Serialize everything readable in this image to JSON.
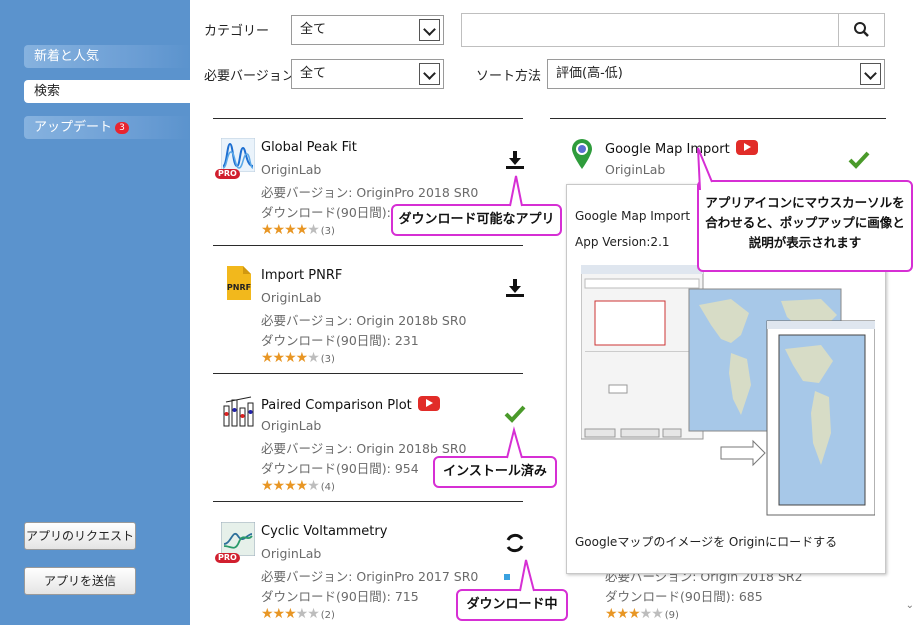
{
  "sidebar": {
    "items": [
      {
        "label": "新着と人気"
      },
      {
        "label": "検索"
      },
      {
        "label": "アップデート",
        "badge": "3"
      }
    ],
    "request_label": "アプリのリクエスト",
    "send_label": "アプリを送信"
  },
  "filters": {
    "category_label": "カテゴリー",
    "category_value": "全て",
    "version_label": "必要バージョン",
    "version_value": "全て",
    "sort_label": "ソート方法",
    "sort_value": "評価(高-低)",
    "search_value": ""
  },
  "apps_left": [
    {
      "name": "Global Peak Fit",
      "publisher": "OriginLab",
      "version": "必要バージョン: OriginPro 2018 SR0",
      "downloads": "ダウンロード(90日間): 8",
      "rating": 4,
      "rating_count": "(3)",
      "pro": true,
      "youtube": false,
      "action": "download"
    },
    {
      "name": "Import PNRF",
      "publisher": "OriginLab",
      "version": "必要バージョン: Origin 2018b SR0",
      "downloads": "ダウンロード(90日間): 231",
      "rating": 4,
      "rating_count": "(3)",
      "pro": false,
      "youtube": false,
      "action": "download"
    },
    {
      "name": "Paired Comparison Plot",
      "publisher": "OriginLab",
      "version": "必要バージョン: Origin 2018b SR0",
      "downloads": "ダウンロード(90日間): 954",
      "rating": 4,
      "rating_count": "(4)",
      "pro": false,
      "youtube": true,
      "action": "installed"
    },
    {
      "name": "Cyclic Voltammetry",
      "publisher": "OriginLab",
      "version": "必要バージョン: OriginPro 2017 SR0",
      "downloads": "ダウンロード(90日間): 715",
      "rating": 3,
      "rating_count": "(2)",
      "pro": true,
      "youtube": false,
      "action": "downloading"
    }
  ],
  "apps_right": [
    {
      "name": "Google Map Import",
      "publisher": "OriginLab",
      "version": "必要バージョン: ...",
      "rating_count": "",
      "youtube": true,
      "action": "installed"
    },
    {
      "name": "",
      "publisher": "",
      "version": "必要バージョン: Origin 2018 SR2",
      "downloads": "ダウンロード(90日間): 685",
      "rating": 3,
      "rating_count": "(9)"
    }
  ],
  "popup": {
    "title": "Google Map Import",
    "version": "App Version:2.1",
    "description": "Googleマップのイメージを Originにロードする"
  },
  "callouts": {
    "downloadable": "ダウンロード可能なアプリ",
    "installed": "インストール済み",
    "downloading": "ダウンロード中",
    "hover_line1": "アプリアイコンにマウスカーソルを",
    "hover_line2": "合わせると、ポップアップに画像と",
    "hover_line3": "説明が表示されます"
  },
  "colors": {
    "sidebar": "#5b93cd",
    "star": "#e89624",
    "callout_border": "#d62fd4",
    "installed_check": "#4a9a2a",
    "youtube": "#e12c28",
    "badge": "#e8242f"
  }
}
